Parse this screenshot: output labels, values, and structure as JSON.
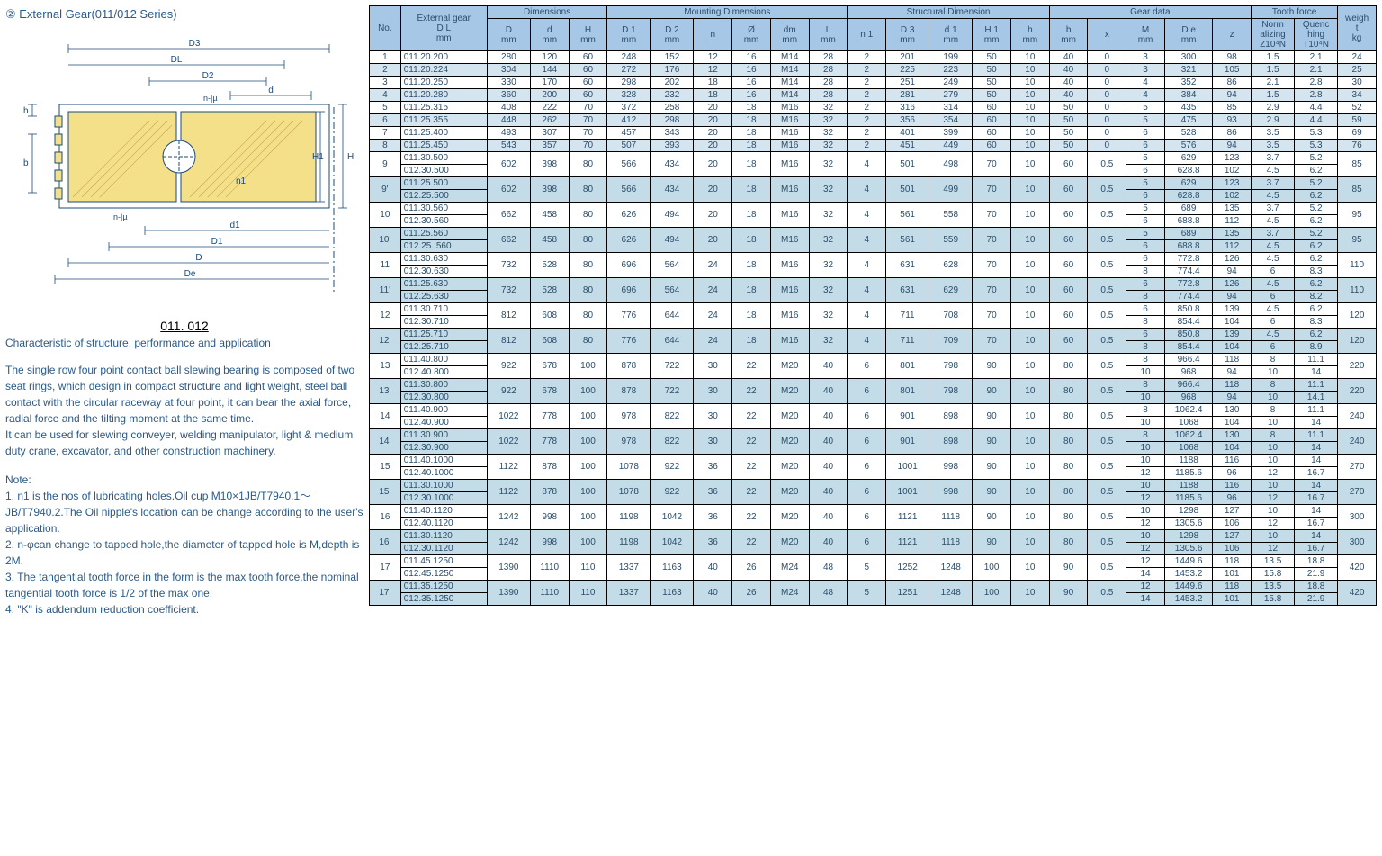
{
  "title": "②  External Gear(011/012 Series)",
  "model": "011. 012",
  "subtitle": "Characteristic of structure, performance and application",
  "desc": "The single row four point contact ball slewing bearing is composed of two seat rings, which design in compact structure and light weight, steel ball contact with the circular raceway at four point, it can bear the axial force, radial force and the tilting moment at the same time.\nIt can be used for slewing conveyer, welding manipulator, light & medium duty crane, excavator, and other construction machinery.",
  "note_label": "Note:",
  "notes": "1. n1 is the nos of lubricating holes.Oil cup M10×1JB/T7940.1～JB/T7940.2.The Oil nipple's    location can be change according to the user's application.\n2. n-φcan change to tapped hole,the diameter of tapped hole is M,depth is 2M.\n3. The tangential tooth force in the form is the max tooth force,the nominal tangential    tooth force is 1/2 of the max one.\n4. \"K\" is addendum reduction coefficient.",
  "diagram_labels": {
    "D3": "D3",
    "DL": "DL",
    "D2": "D2",
    "d": "d",
    "H1": "H1",
    "H": "H",
    "d1": "d1",
    "D1": "D1",
    "D": "D",
    "De": "De",
    "h": "h",
    "b": "b",
    "n1": "n1",
    "nmu": "n-|µ"
  },
  "headers": {
    "no": "No.",
    "ext": "External gear\nD L\nmm",
    "dim": "Dimensions",
    "mount": "Mounting Dimensions",
    "struct": "Structural Dimension",
    "gear": "Gear data",
    "tooth": "Tooth force",
    "weight": "weigh\nt\nkg",
    "D": "D\nmm",
    "d": "d\nmm",
    "H": "H\nmm",
    "D1": "D 1\nmm",
    "D2": "D 2\nmm",
    "n": "n",
    "phi": "Ø\nmm",
    "dm": "dm\nmm",
    "L": "L\nmm",
    "n1": "n 1",
    "D3": "D 3\nmm",
    "d1": "d 1\nmm",
    "H1": "H 1\nmm",
    "h": "h\nmm",
    "b": "b\nmm",
    "x": "x",
    "M": "M\nmm",
    "De": "D e\nmm",
    "z": "z",
    "norm": "Norm\nalizing\nZ10⁴N",
    "quench": "Quenc\nhing\nT10⁴N"
  },
  "rows": [
    {
      "no": "1",
      "g": [
        "011.20.200"
      ],
      "v": [
        "280",
        "120",
        "60",
        "248",
        "152",
        "12",
        "16",
        "M14",
        "28",
        "2",
        "201",
        "199",
        "50",
        "10",
        "40",
        "0"
      ],
      "gd": [
        [
          "3",
          "300",
          "98",
          "1.5",
          "2.1"
        ]
      ],
      "w": "24",
      "cls": "even"
    },
    {
      "no": "2",
      "g": [
        "011.20.224"
      ],
      "v": [
        "304",
        "144",
        "60",
        "272",
        "176",
        "12",
        "16",
        "M14",
        "28",
        "2",
        "225",
        "223",
        "50",
        "10",
        "40",
        "0"
      ],
      "gd": [
        [
          "3",
          "321",
          "105",
          "1.5",
          "2.1"
        ]
      ],
      "w": "25",
      "cls": "odd"
    },
    {
      "no": "3",
      "g": [
        "011.20.250"
      ],
      "v": [
        "330",
        "170",
        "60",
        "298",
        "202",
        "18",
        "16",
        "M14",
        "28",
        "2",
        "251",
        "249",
        "50",
        "10",
        "40",
        "0"
      ],
      "gd": [
        [
          "4",
          "352",
          "86",
          "2.1",
          "2.8"
        ]
      ],
      "w": "30",
      "cls": "even"
    },
    {
      "no": "4",
      "g": [
        "011.20.280"
      ],
      "v": [
        "360",
        "200",
        "60",
        "328",
        "232",
        "18",
        "16",
        "M14",
        "28",
        "2",
        "281",
        "279",
        "50",
        "10",
        "40",
        "0"
      ],
      "gd": [
        [
          "4",
          "384",
          "94",
          "1.5",
          "2.8"
        ]
      ],
      "w": "34",
      "cls": "odd"
    },
    {
      "no": "5",
      "g": [
        "011.25.315"
      ],
      "v": [
        "408",
        "222",
        "70",
        "372",
        "258",
        "20",
        "18",
        "M16",
        "32",
        "2",
        "316",
        "314",
        "60",
        "10",
        "50",
        "0"
      ],
      "gd": [
        [
          "5",
          "435",
          "85",
          "2.9",
          "4.4"
        ]
      ],
      "w": "52",
      "cls": "even"
    },
    {
      "no": "6",
      "g": [
        "011.25.355"
      ],
      "v": [
        "448",
        "262",
        "70",
        "412",
        "298",
        "20",
        "18",
        "M16",
        "32",
        "2",
        "356",
        "354",
        "60",
        "10",
        "50",
        "0"
      ],
      "gd": [
        [
          "5",
          "475",
          "93",
          "2.9",
          "4.4"
        ]
      ],
      "w": "59",
      "cls": "odd"
    },
    {
      "no": "7",
      "g": [
        "011.25.400"
      ],
      "v": [
        "493",
        "307",
        "70",
        "457",
        "343",
        "20",
        "18",
        "M16",
        "32",
        "2",
        "401",
        "399",
        "60",
        "10",
        "50",
        "0"
      ],
      "gd": [
        [
          "6",
          "528",
          "86",
          "3.5",
          "5.3"
        ]
      ],
      "w": "69",
      "cls": "even"
    },
    {
      "no": "8",
      "g": [
        "011.25.450"
      ],
      "v": [
        "543",
        "357",
        "70",
        "507",
        "393",
        "20",
        "18",
        "M16",
        "32",
        "2",
        "451",
        "449",
        "60",
        "10",
        "50",
        "0"
      ],
      "gd": [
        [
          "6",
          "576",
          "94",
          "3.5",
          "5.3"
        ]
      ],
      "w": "76",
      "cls": "odd"
    },
    {
      "no": "9",
      "g": [
        "011.30.500",
        "012.30.500"
      ],
      "v": [
        "602",
        "398",
        "80",
        "566",
        "434",
        "20",
        "18",
        "M16",
        "32",
        "4",
        "501",
        "498",
        "70",
        "10",
        "60",
        "0.5"
      ],
      "gd": [
        [
          "5",
          "629",
          "123",
          "3.7",
          "5.2"
        ],
        [
          "6",
          "628.8",
          "102",
          "4.5",
          "6.2"
        ]
      ],
      "w": "85",
      "cls": "even"
    },
    {
      "no": "9'",
      "g": [
        "011.25.500",
        "012.25.500"
      ],
      "v": [
        "602",
        "398",
        "80",
        "566",
        "434",
        "20",
        "18",
        "M16",
        "32",
        "4",
        "501",
        "499",
        "70",
        "10",
        "60",
        "0.5"
      ],
      "gd": [
        [
          "5",
          "629",
          "123",
          "3.7",
          "5.2"
        ],
        [
          "6",
          "628.8",
          "102",
          "4.5",
          "6.2"
        ]
      ],
      "w": "85",
      "cls": "odd-alt"
    },
    {
      "no": "10",
      "g": [
        "011.30.560",
        "012.30.560"
      ],
      "v": [
        "662",
        "458",
        "80",
        "626",
        "494",
        "20",
        "18",
        "M16",
        "32",
        "4",
        "561",
        "558",
        "70",
        "10",
        "60",
        "0.5"
      ],
      "gd": [
        [
          "5",
          "689",
          "135",
          "3.7",
          "5.2"
        ],
        [
          "6",
          "688.8",
          "112",
          "4.5",
          "6.2"
        ]
      ],
      "w": "95",
      "cls": "even"
    },
    {
      "no": "10'",
      "g": [
        "011.25.560",
        "012.25. 560"
      ],
      "v": [
        "662",
        "458",
        "80",
        "626",
        "494",
        "20",
        "18",
        "M16",
        "32",
        "4",
        "561",
        "559",
        "70",
        "10",
        "60",
        "0.5"
      ],
      "gd": [
        [
          "5",
          "689",
          "135",
          "3.7",
          "5.2"
        ],
        [
          "6",
          "688.8",
          "112",
          "4.5",
          "6.2"
        ]
      ],
      "w": "95",
      "cls": "odd-alt"
    },
    {
      "no": "11",
      "g": [
        "011.30.630",
        "012.30.630"
      ],
      "v": [
        "732",
        "528",
        "80",
        "696",
        "564",
        "24",
        "18",
        "M16",
        "32",
        "4",
        "631",
        "628",
        "70",
        "10",
        "60",
        "0.5"
      ],
      "gd": [
        [
          "6",
          "772.8",
          "126",
          "4.5",
          "6.2"
        ],
        [
          "8",
          "774.4",
          "94",
          "6",
          "8.3"
        ]
      ],
      "w": "110",
      "cls": "even"
    },
    {
      "no": "11'",
      "g": [
        "011.25.630",
        "012.25.630"
      ],
      "v": [
        "732",
        "528",
        "80",
        "696",
        "564",
        "24",
        "18",
        "M16",
        "32",
        "4",
        "631",
        "629",
        "70",
        "10",
        "60",
        "0.5"
      ],
      "gd": [
        [
          "6",
          "772.8",
          "126",
          "4.5",
          "6.2"
        ],
        [
          "8",
          "774.4",
          "94",
          "6",
          "8.2"
        ]
      ],
      "w": "110",
      "cls": "odd-alt"
    },
    {
      "no": "12",
      "g": [
        "011.30.710",
        "012.30.710"
      ],
      "v": [
        "812",
        "608",
        "80",
        "776",
        "644",
        "24",
        "18",
        "M16",
        "32",
        "4",
        "711",
        "708",
        "70",
        "10",
        "60",
        "0.5"
      ],
      "gd": [
        [
          "6",
          "850.8",
          "139",
          "4.5",
          "6.2"
        ],
        [
          "8",
          "854.4",
          "104",
          "6",
          "8.3"
        ]
      ],
      "w": "120",
      "cls": "even"
    },
    {
      "no": "12'",
      "g": [
        "011.25.710",
        "012.25.710"
      ],
      "v": [
        "812",
        "608",
        "80",
        "776",
        "644",
        "24",
        "18",
        "M16",
        "32",
        "4",
        "711",
        "709",
        "70",
        "10",
        "60",
        "0.5"
      ],
      "gd": [
        [
          "6",
          "850.8",
          "139",
          "4.5",
          "6.2"
        ],
        [
          "8",
          "854.4",
          "104",
          "6",
          "8.9"
        ]
      ],
      "w": "120",
      "cls": "odd-alt"
    },
    {
      "no": "13",
      "g": [
        "011.40.800",
        "012.40.800"
      ],
      "v": [
        "922",
        "678",
        "100",
        "878",
        "722",
        "30",
        "22",
        "M20",
        "40",
        "6",
        "801",
        "798",
        "90",
        "10",
        "80",
        "0.5"
      ],
      "gd": [
        [
          "8",
          "966.4",
          "118",
          "8",
          "11.1"
        ],
        [
          "10",
          "968",
          "94",
          "10",
          "14"
        ]
      ],
      "w": "220",
      "cls": "even"
    },
    {
      "no": "13'",
      "g": [
        "011.30.800",
        "012.30.800"
      ],
      "v": [
        "922",
        "678",
        "100",
        "878",
        "722",
        "30",
        "22",
        "M20",
        "40",
        "6",
        "801",
        "798",
        "90",
        "10",
        "80",
        "0.5"
      ],
      "gd": [
        [
          "8",
          "966.4",
          "118",
          "8",
          "11.1"
        ],
        [
          "10",
          "968",
          "94",
          "10",
          "14.1"
        ]
      ],
      "w": "220",
      "cls": "odd-alt"
    },
    {
      "no": "14",
      "g": [
        "011.40.900",
        "012.40.900"
      ],
      "v": [
        "1022",
        "778",
        "100",
        "978",
        "822",
        "30",
        "22",
        "M20",
        "40",
        "6",
        "901",
        "898",
        "90",
        "10",
        "80",
        "0.5"
      ],
      "gd": [
        [
          "8",
          "1062.4",
          "130",
          "8",
          "11.1"
        ],
        [
          "10",
          "1068",
          "104",
          "10",
          "14"
        ]
      ],
      "w": "240",
      "cls": "even"
    },
    {
      "no": "14'",
      "g": [
        "011.30.900",
        "012.30.900"
      ],
      "v": [
        "1022",
        "778",
        "100",
        "978",
        "822",
        "30",
        "22",
        "M20",
        "40",
        "6",
        "901",
        "898",
        "90",
        "10",
        "80",
        "0.5"
      ],
      "gd": [
        [
          "8",
          "1062.4",
          "130",
          "8",
          "11.1"
        ],
        [
          "10",
          "1068",
          "104",
          "10",
          "14"
        ]
      ],
      "w": "240",
      "cls": "odd-alt"
    },
    {
      "no": "15",
      "g": [
        "011.40.1000",
        "012.40.1000"
      ],
      "v": [
        "1122",
        "878",
        "100",
        "1078",
        "922",
        "36",
        "22",
        "M20",
        "40",
        "6",
        "1001",
        "998",
        "90",
        "10",
        "80",
        "0.5"
      ],
      "gd": [
        [
          "10",
          "1188",
          "116",
          "10",
          "14"
        ],
        [
          "12",
          "1185.6",
          "96",
          "12",
          "16.7"
        ]
      ],
      "w": "270",
      "cls": "even"
    },
    {
      "no": "15'",
      "g": [
        "011.30.1000",
        "012.30.1000"
      ],
      "v": [
        "1122",
        "878",
        "100",
        "1078",
        "922",
        "36",
        "22",
        "M20",
        "40",
        "6",
        "1001",
        "998",
        "90",
        "10",
        "80",
        "0.5"
      ],
      "gd": [
        [
          "10",
          "1188",
          "116",
          "10",
          "14"
        ],
        [
          "12",
          "1185.6",
          "96",
          "12",
          "16.7"
        ]
      ],
      "w": "270",
      "cls": "odd-alt"
    },
    {
      "no": "16",
      "g": [
        "011.40.1120",
        "012.40.1120"
      ],
      "v": [
        "1242",
        "998",
        "100",
        "1198",
        "1042",
        "36",
        "22",
        "M20",
        "40",
        "6",
        "1121",
        "1118",
        "90",
        "10",
        "80",
        "0.5"
      ],
      "gd": [
        [
          "10",
          "1298",
          "127",
          "10",
          "14"
        ],
        [
          "12",
          "1305.6",
          "106",
          "12",
          "16.7"
        ]
      ],
      "w": "300",
      "cls": "even"
    },
    {
      "no": "16'",
      "g": [
        "011.30.1120",
        "012.30.1120"
      ],
      "v": [
        "1242",
        "998",
        "100",
        "1198",
        "1042",
        "36",
        "22",
        "M20",
        "40",
        "6",
        "1121",
        "1118",
        "90",
        "10",
        "80",
        "0.5"
      ],
      "gd": [
        [
          "10",
          "1298",
          "127",
          "10",
          "14"
        ],
        [
          "12",
          "1305.6",
          "106",
          "12",
          "16.7"
        ]
      ],
      "w": "300",
      "cls": "odd-alt"
    },
    {
      "no": "17",
      "g": [
        "011.45.1250",
        "012.45.1250"
      ],
      "v": [
        "1390",
        "1110",
        "110",
        "1337",
        "1163",
        "40",
        "26",
        "M24",
        "48",
        "5",
        "1252",
        "1248",
        "100",
        "10",
        "90",
        "0.5"
      ],
      "gd": [
        [
          "12",
          "1449.6",
          "118",
          "13.5",
          "18.8"
        ],
        [
          "14",
          "1453.2",
          "101",
          "15.8",
          "21.9"
        ]
      ],
      "w": "420",
      "cls": "even"
    },
    {
      "no": "17'",
      "g": [
        "011.35.1250",
        "012.35.1250"
      ],
      "v": [
        "1390",
        "1110",
        "110",
        "1337",
        "1163",
        "40",
        "26",
        "M24",
        "48",
        "5",
        "1251",
        "1248",
        "100",
        "10",
        "90",
        "0.5"
      ],
      "gd": [
        [
          "12",
          "1449.6",
          "118",
          "13.5",
          "18.8"
        ],
        [
          "14",
          "1453.2",
          "101",
          "15.8",
          "21.9"
        ]
      ],
      "w": "420",
      "cls": "odd-alt"
    }
  ]
}
